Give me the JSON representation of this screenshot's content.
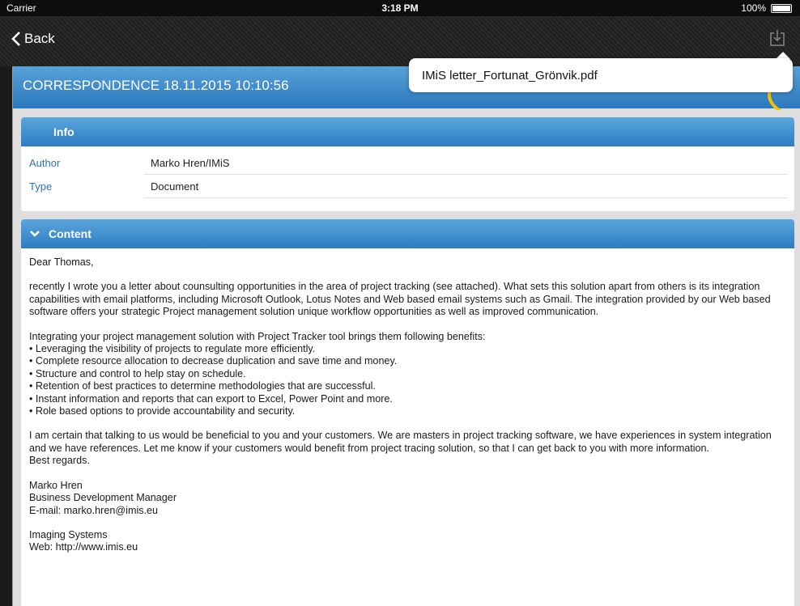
{
  "status_bar": {
    "carrier": "Carrier",
    "time": "3:18 PM",
    "battery": "100%"
  },
  "nav": {
    "back_label": "Back"
  },
  "popover": {
    "file_name": "IMiS letter_Fortunat_Grönvik.pdf"
  },
  "title": "CORRESPONDENCE 18.11.2015 10:10:56",
  "info": {
    "header": "Info",
    "rows": [
      {
        "label": "Author",
        "value": "Marko Hren/IMiS"
      },
      {
        "label": "Type",
        "value": "Document"
      }
    ]
  },
  "content": {
    "header": "Content",
    "greeting": "Dear Thomas,",
    "paragraph1": "recently I wrote you a letter about counsulting opportunities in the area of project tracking (see attached). What sets this solution apart from others is its integration capabilities with email platforms, including Microsoft Outlook, Lotus Notes and Web based email systems such as Gmail. The integration provided by our Web based software offers your strategic Project management solution unique workflow opportunities as well as improved communication.",
    "benefits_intro": "Integrating your project management solution with Project Tracker tool brings them following benefits:",
    "benefits": [
      "• Leveraging the visibility of projects to regulate more efficiently.",
      "• Complete resource allocation to decrease duplication and save time and money.",
      "• Structure and control to help stay on schedule.",
      "• Retention of best practices to determine methodologies that are successful.",
      "• Instant information and reports that can export to Excel, Power Point and more.",
      "• Role based options to provide accountability and security."
    ],
    "paragraph2": "I am certain that talking to us would be beneficial to you and your customers. We are masters in project tracking software, we have experiences in system integration and we have references. Let me know if your customers would benefit from project tracing solution, so that I can get back to you with more information.",
    "closing": "Best regards.",
    "signature": [
      "Marko Hren",
      "Business Development Manager",
      "E-mail: marko.hren@imis.eu"
    ],
    "company": [
      "Imaging Systems",
      "Web: http://www.imis.eu"
    ]
  }
}
